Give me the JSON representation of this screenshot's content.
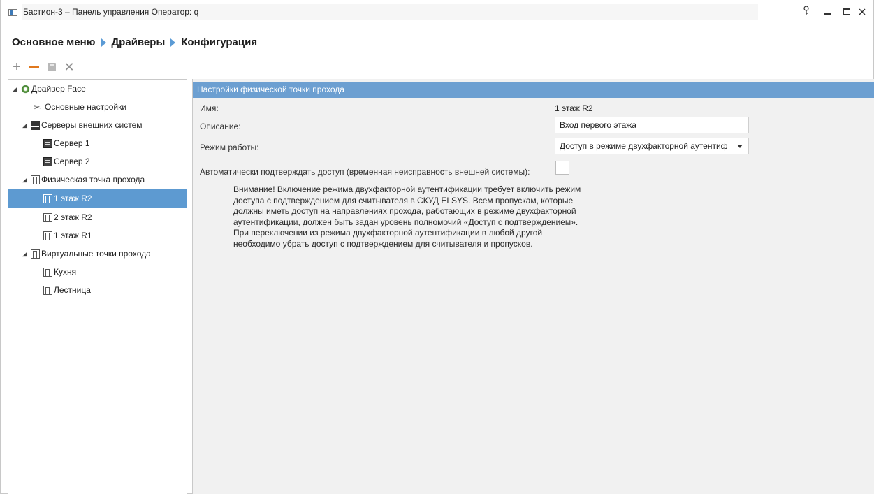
{
  "window": {
    "title": "Бастион-3 – Панель управления Оператор: q"
  },
  "breadcrumb": {
    "items": [
      "Основное меню",
      "Драйверы",
      "Конфигурация"
    ]
  },
  "toolbar": {
    "add_icon": "plus-icon",
    "remove_icon": "minus-icon",
    "save_icon": "save-icon",
    "delete_icon": "close-icon"
  },
  "tree": {
    "items": [
      {
        "label": "Драйвер Face",
        "icon": "gear-icon"
      },
      {
        "label": "Основные настройки",
        "icon": "tools-icon"
      },
      {
        "label": "Серверы внешних систем",
        "icon": "servers-icon"
      },
      {
        "label": "Сервер 1",
        "icon": "server-icon"
      },
      {
        "label": "Сервер 2",
        "icon": "server-icon"
      },
      {
        "label": "Физическая точка прохода",
        "icon": "door-icon"
      },
      {
        "label": "1 этаж R2",
        "icon": "door-icon"
      },
      {
        "label": "2 этаж R2",
        "icon": "door-icon"
      },
      {
        "label": "1 этаж R1",
        "icon": "door-icon"
      },
      {
        "label": "Виртуальные точки прохода",
        "icon": "door-icon"
      },
      {
        "label": "Кухня",
        "icon": "door-icon"
      },
      {
        "label": "Лестница",
        "icon": "door-icon"
      }
    ],
    "selected": "1 этаж R2"
  },
  "panel": {
    "header": "Настройки физической точки прохода",
    "name_label": "Имя:",
    "name_value": "1 этаж R2",
    "description_label": "Описание:",
    "description_value": "Вход первого этажа",
    "mode_label": "Режим работы:",
    "mode_value": "Доступ в режиме двухфакторной аутентиф",
    "auto_confirm_label": "Автоматически подтверждать доступ (временная неисправность внешней системы):",
    "auto_confirm_checked": false,
    "notice_lines": [
      "Внимание! Включение режима двухфакторной аутентификации требует включить режим",
      "доступа с подтверждением для считывателя в СКУД ELSYS. Всем пропускам, которые",
      "должны иметь доступ на направлениях прохода, работающих в режиме двухфакторной",
      "аутентификации, должен быть задан уровень полномочий «Доступ с подтверждением».",
      "При переключении из режима двухфакторной аутентификации в любой другой",
      "необходимо убрать доступ с подтверждением для считывателя и пропусков."
    ]
  },
  "colors": {
    "accent": "#6c9fd1",
    "selection": "#5d9ad1",
    "remove_icon": "#e0781e"
  }
}
